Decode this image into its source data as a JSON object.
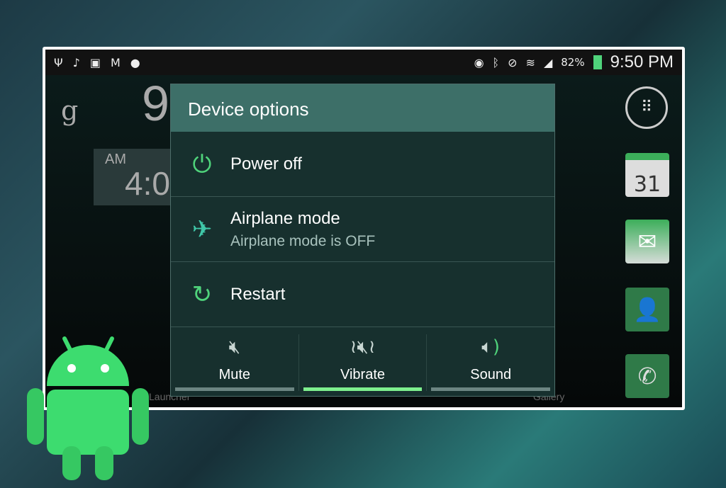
{
  "status_bar": {
    "left_icons": [
      "usb-icon",
      "music-icon",
      "gallery-icon",
      "gmail-icon",
      "dropbox-icon"
    ],
    "right_icons": [
      "smart-stay-eye-icon",
      "bluetooth-icon",
      "vibrate-icon",
      "wifi-icon",
      "signal-icon"
    ],
    "battery": "82%",
    "time": "9:50 PM"
  },
  "home": {
    "clock_hour": "9",
    "am": "AM",
    "alarm_time": "4:0",
    "launcher": "Launcher",
    "gallery": "Gallery",
    "google": "g",
    "calendar_day": "31"
  },
  "dialog": {
    "title": "Device options",
    "items": [
      {
        "label": "Power off",
        "icon": "power-icon"
      },
      {
        "label": "Airplane mode",
        "sublabel": "Airplane mode is OFF",
        "icon": "airplane-icon"
      },
      {
        "label": "Restart",
        "icon": "restart-icon"
      }
    ],
    "modes": [
      {
        "label": "Mute",
        "active": false
      },
      {
        "label": "Vibrate",
        "active": true
      },
      {
        "label": "Sound",
        "active": false
      }
    ]
  },
  "colors": {
    "accent": "#4fd37b",
    "active_bar": "#7ef08e",
    "title_bar": "#3d6f68"
  }
}
